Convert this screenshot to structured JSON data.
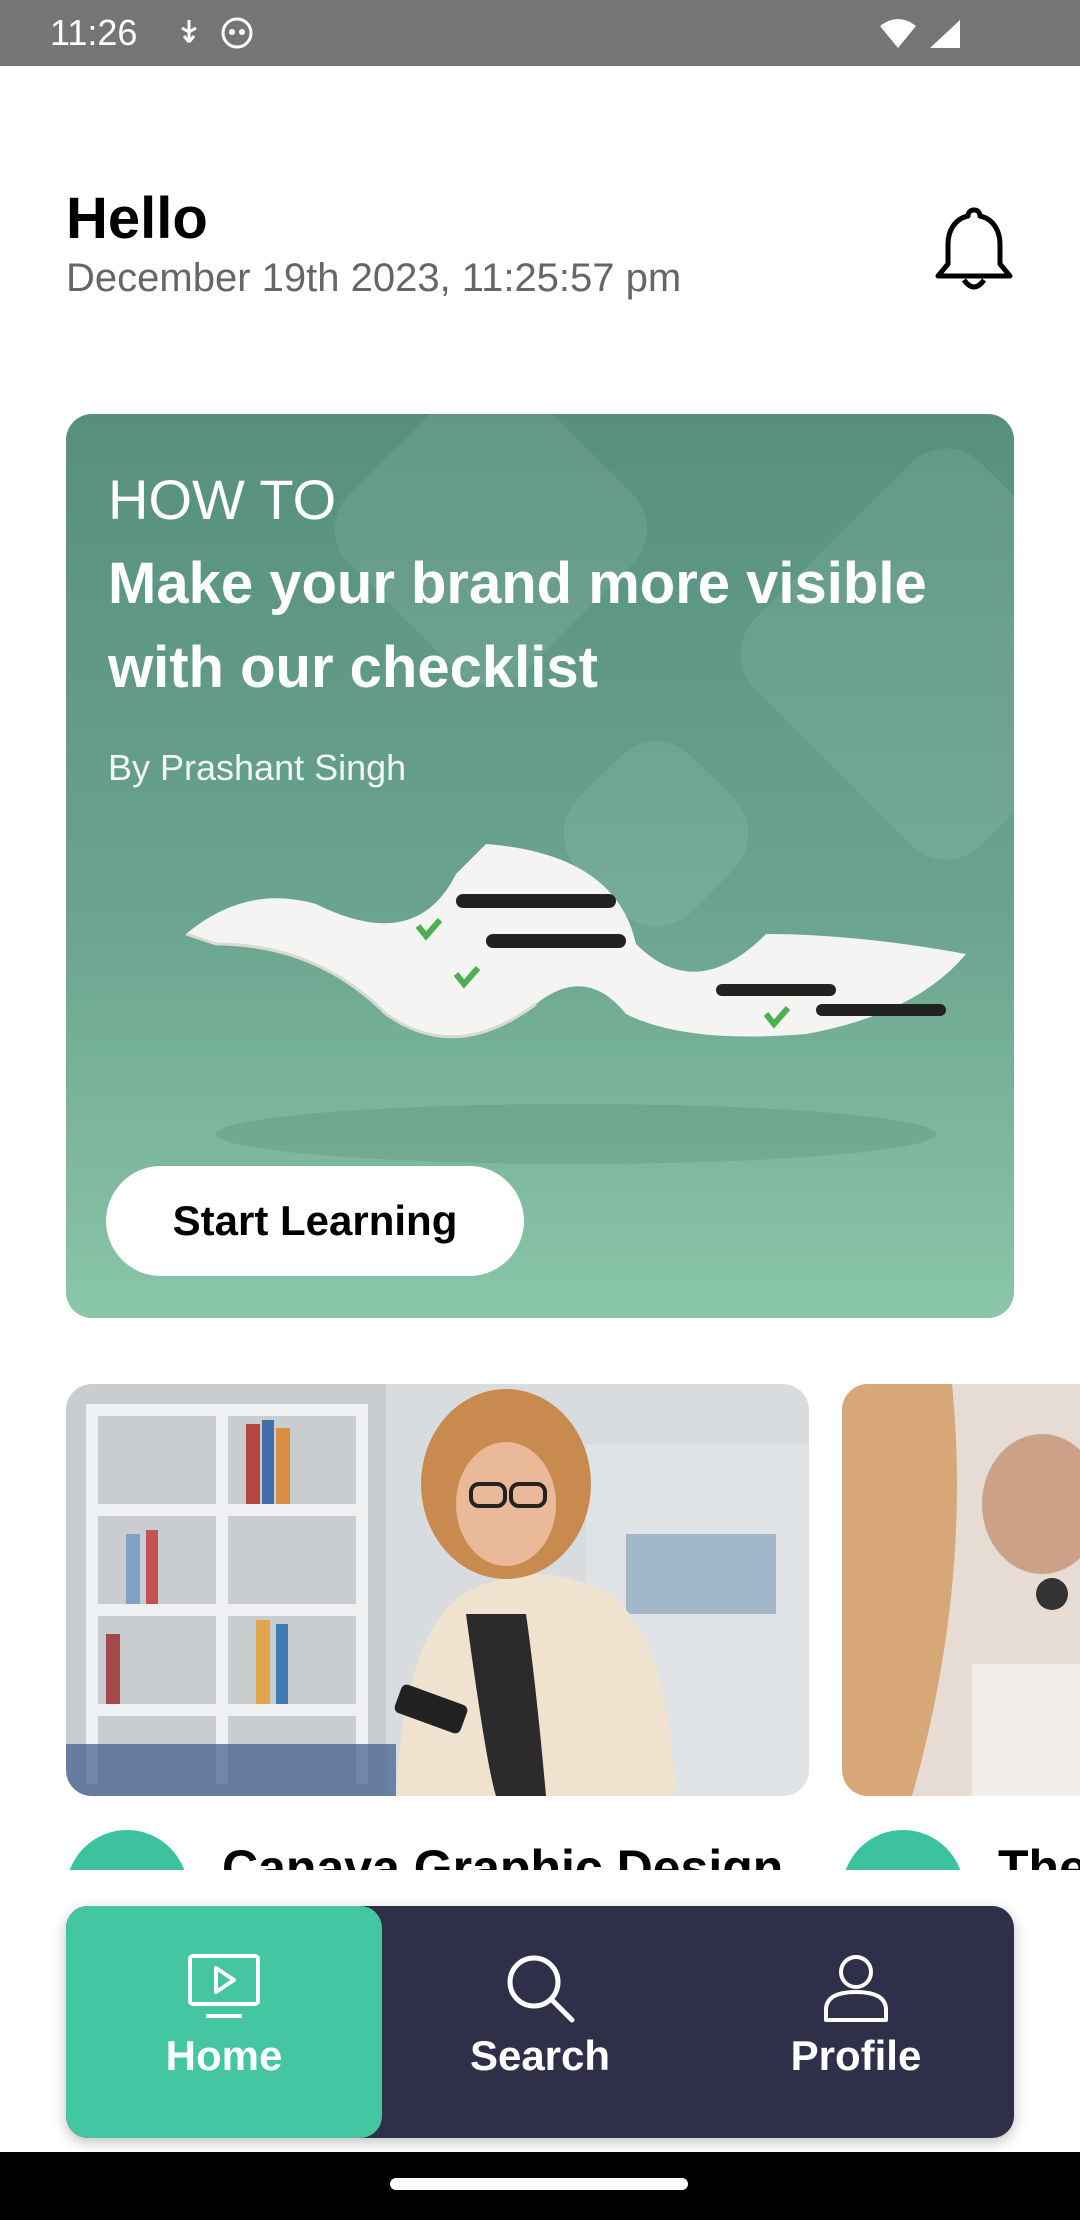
{
  "status_bar": {
    "time": "11:26"
  },
  "header": {
    "greeting": "Hello",
    "datetime": "December 19th 2023, 11:25:57 pm"
  },
  "hero": {
    "kicker": "HOW TO",
    "title": "Make your brand more visible with our checklist",
    "author": "By Prashant Singh",
    "cta_label": "Start Learning"
  },
  "courses": [
    {
      "title": "Canava Graphic Design"
    },
    {
      "title": "The"
    }
  ],
  "nav": [
    {
      "label": "Home",
      "icon": "tv-play-icon",
      "active": true
    },
    {
      "label": "Search",
      "icon": "search-icon",
      "active": false
    },
    {
      "label": "Profile",
      "icon": "user-icon",
      "active": false
    }
  ],
  "colors": {
    "accent": "#43c6a1",
    "nav_bg": "#2f2f4a",
    "hero_top": "#568f7e",
    "hero_bottom": "#8ac6a9"
  }
}
